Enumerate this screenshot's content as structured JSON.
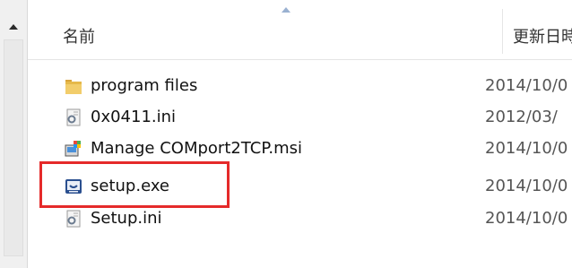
{
  "columns": {
    "name": "名前",
    "date": "更新日時"
  },
  "files": [
    {
      "name": "program files",
      "date": "2014/10/0",
      "icon": "folder-icon"
    },
    {
      "name": "0x0411.ini",
      "date": "2012/03/",
      "icon": "ini-settings-icon"
    },
    {
      "name": "Manage COMport2TCP.msi",
      "date": "2014/10/0",
      "icon": "msi-installer-icon"
    },
    {
      "name": "setup.exe",
      "date": "2014/10/0",
      "icon": "exe-setup-icon"
    },
    {
      "name": "Setup.ini",
      "date": "2014/10/0",
      "icon": "ini-settings-icon"
    }
  ],
  "colors": {
    "highlight": "#e52a2a",
    "folder": "#e6b94a",
    "exe": "#2a4f8f"
  }
}
